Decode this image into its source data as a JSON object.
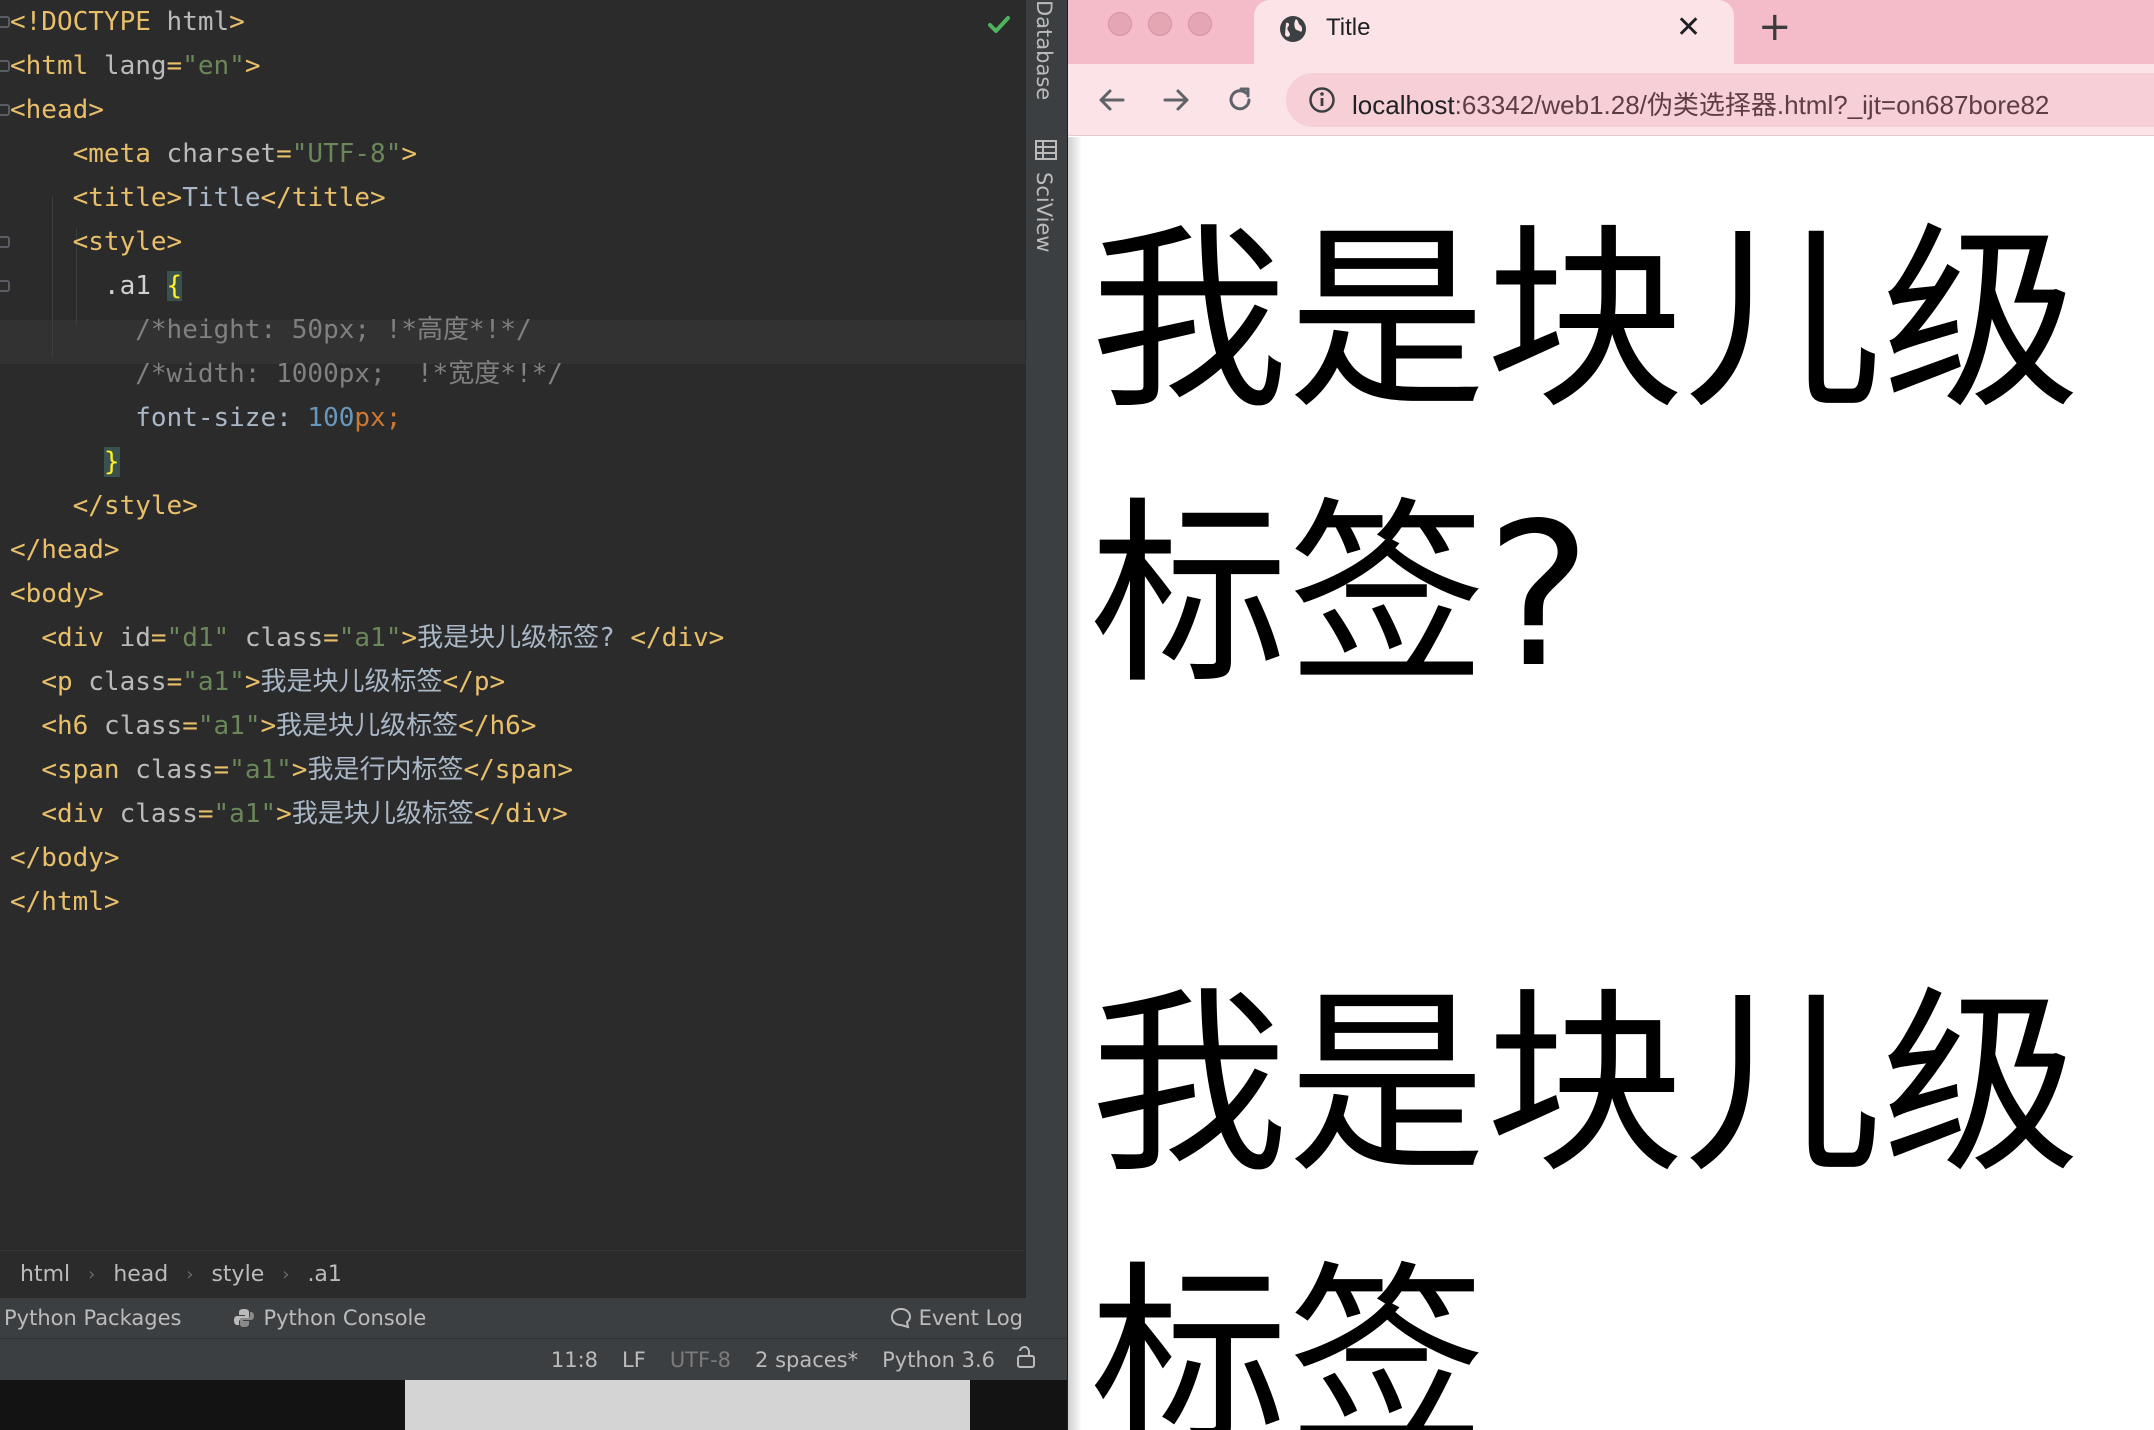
{
  "ide": {
    "code_lines": [
      {
        "parts": [
          [
            "t",
            "<!DOCTYPE "
          ],
          [
            "a",
            "html"
          ],
          [
            "t",
            ">"
          ]
        ]
      },
      {
        "parts": [
          [
            "t",
            "<html "
          ],
          [
            "a",
            "lang"
          ],
          [
            "t",
            "="
          ],
          [
            "s",
            "\"en\""
          ],
          [
            "t",
            ">"
          ]
        ]
      },
      {
        "parts": [
          [
            "t",
            "<head>"
          ]
        ]
      },
      {
        "parts": [
          [
            "p",
            "    "
          ],
          [
            "t",
            "<meta "
          ],
          [
            "a",
            "charset"
          ],
          [
            "t",
            "="
          ],
          [
            "s",
            "\"UTF-8\""
          ],
          [
            "t",
            ">"
          ]
        ]
      },
      {
        "parts": [
          [
            "p",
            "    "
          ],
          [
            "t",
            "<title>"
          ],
          [
            "p",
            "Title"
          ],
          [
            "t",
            "</title>"
          ]
        ]
      },
      {
        "parts": [
          [
            "p",
            "    "
          ],
          [
            "t",
            "<style>"
          ]
        ]
      },
      {
        "parts": [
          [
            "p",
            "      "
          ],
          [
            "sel",
            ".a1 "
          ],
          [
            "br",
            "{"
          ]
        ]
      },
      {
        "parts": [
          [
            "p",
            "        "
          ],
          [
            "c",
            "/*height: 50px; !*高度*!*/"
          ]
        ]
      },
      {
        "parts": [
          [
            "p",
            "        "
          ],
          [
            "c",
            "/*width: 1000px;  !*宽度*!*/"
          ]
        ]
      },
      {
        "parts": [
          [
            "p",
            "        "
          ],
          [
            "p",
            "font-size: "
          ],
          [
            "n",
            "100"
          ],
          [
            "k",
            "px;"
          ]
        ]
      },
      {
        "parts": [
          [
            "p",
            "      "
          ],
          [
            "br",
            "}"
          ]
        ]
      },
      {
        "parts": [
          [
            "p",
            "    "
          ],
          [
            "t",
            "</style>"
          ]
        ]
      },
      {
        "parts": [
          [
            "t",
            "</head>"
          ]
        ]
      },
      {
        "parts": [
          [
            "t",
            "<body>"
          ]
        ]
      },
      {
        "parts": [
          [
            "p",
            "  "
          ],
          [
            "t",
            "<div "
          ],
          [
            "a",
            "id"
          ],
          [
            "t",
            "="
          ],
          [
            "s",
            "\"d1\""
          ],
          [
            "p",
            " "
          ],
          [
            "a",
            "class"
          ],
          [
            "t",
            "="
          ],
          [
            "s",
            "\"a1\""
          ],
          [
            "t",
            ">"
          ],
          [
            "p",
            "我是块儿级标签? "
          ],
          [
            "t",
            "</div>"
          ]
        ]
      },
      {
        "parts": [
          [
            "p",
            "  "
          ],
          [
            "t",
            "<p "
          ],
          [
            "a",
            "class"
          ],
          [
            "t",
            "="
          ],
          [
            "s",
            "\"a1\""
          ],
          [
            "t",
            ">"
          ],
          [
            "p",
            "我是块儿级标签"
          ],
          [
            "t",
            "</p>"
          ]
        ]
      },
      {
        "parts": [
          [
            "p",
            "  "
          ],
          [
            "t",
            "<h6 "
          ],
          [
            "a",
            "class"
          ],
          [
            "t",
            "="
          ],
          [
            "s",
            "\"a1\""
          ],
          [
            "t",
            ">"
          ],
          [
            "p",
            "我是块儿级标签"
          ],
          [
            "t",
            "</h6>"
          ]
        ]
      },
      {
        "parts": [
          [
            "p",
            "  "
          ],
          [
            "t",
            "<span "
          ],
          [
            "a",
            "class"
          ],
          [
            "t",
            "="
          ],
          [
            "s",
            "\"a1\""
          ],
          [
            "t",
            ">"
          ],
          [
            "p",
            "我是行内标签"
          ],
          [
            "t",
            "</span>"
          ]
        ]
      },
      {
        "parts": [
          [
            "p",
            "  "
          ],
          [
            "t",
            "<div "
          ],
          [
            "a",
            "class"
          ],
          [
            "t",
            "="
          ],
          [
            "s",
            "\"a1\""
          ],
          [
            "t",
            ">"
          ],
          [
            "p",
            "我是块儿级标签"
          ],
          [
            "t",
            "</div>"
          ]
        ]
      },
      {
        "parts": [
          [
            "t",
            "</body>"
          ]
        ]
      },
      {
        "parts": [
          [
            "t",
            "</html>"
          ]
        ]
      }
    ],
    "side_tabs": [
      "Database",
      "SciView"
    ],
    "breadcrumb": [
      "html",
      "head",
      "style",
      ".a1"
    ],
    "tool_windows": {
      "python_packages": "Python Packages",
      "python_console": "Python Console",
      "event_log": "Event Log"
    },
    "status": {
      "position": "11:8",
      "line_sep": "LF",
      "encoding": "UTF-8",
      "indent": "2 spaces*",
      "interpreter": "Python 3.6"
    }
  },
  "browser": {
    "tab_title": "Title",
    "url_host": "localhost",
    "url_rest": ":63342/web1.28/伪类选择器.html?_ijt=on687bore82",
    "content": {
      "line1": "我是块儿级",
      "line2": "标签?",
      "line3": "我是块儿级",
      "line4": "标签"
    }
  },
  "colors": {
    "tag": "#e8bf6a",
    "string": "#6a8759",
    "comment": "#808080",
    "number": "#6897bb",
    "browser_chrome": "#f3bcc8"
  }
}
